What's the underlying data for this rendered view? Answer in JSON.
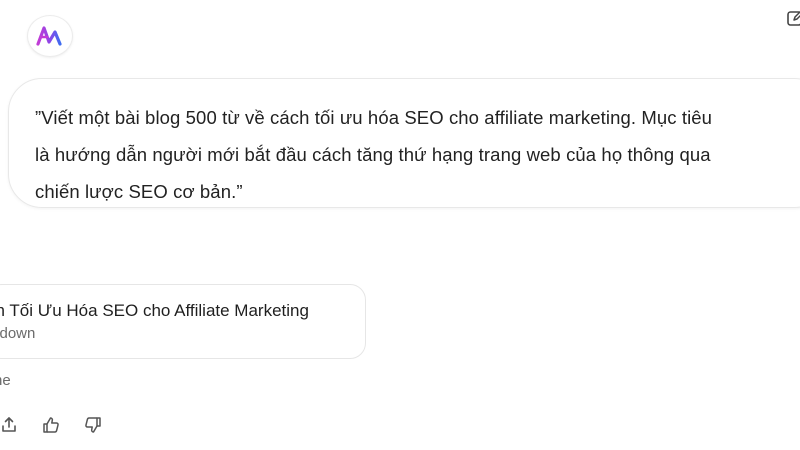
{
  "prompt": {
    "text": "”Viết một bài blog 500 từ về cách tối ưu hóa SEO cho affiliate marketing. Mục tiêu\nlà hướng dẫn người mới bắt đầu cách tăng thứ hạng trang web của họ thông qua\nchiến lược SEO cơ bản.”"
  },
  "document": {
    "title": "ch Tối Ưu Hóa SEO cho Affiliate Marketing",
    "type": "rkdown"
  },
  "status": {
    "text": "ne"
  },
  "icons": {
    "logo": "assistant-logo",
    "corner": "edit-icon",
    "share": "share-icon",
    "like": "thumbs-up-icon",
    "dislike": "thumbs-down-icon"
  },
  "colors": {
    "logo_purple": "#b43ee0",
    "logo_blue": "#3f6cf0",
    "icon_gray": "#555555"
  }
}
